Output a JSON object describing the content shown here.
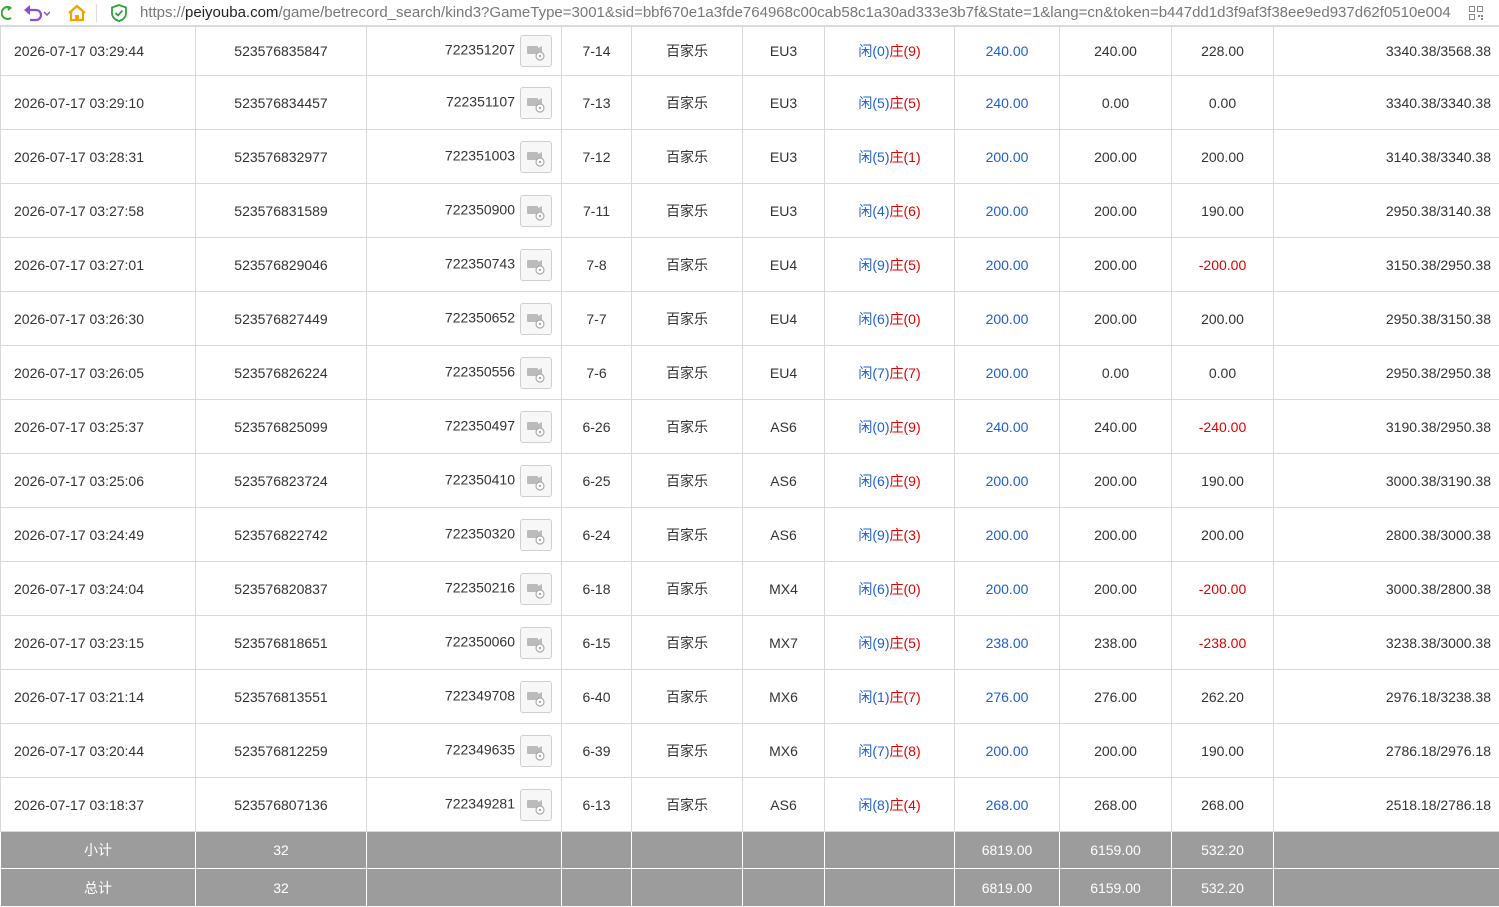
{
  "browser": {
    "url_scheme": "https://",
    "url_host": "peiyouba.com",
    "url_path": "/game/betrecord_search/kind3?GameType=3001&sid=bbf670e1a3fde764968c00cab58c1a30ad333e3b7f&State=1&lang=cn&token=b447dd1d3f9af3f38ee9ed937d62f0510e004",
    "icons": [
      "refresh-icon",
      "undo-icon",
      "home-icon",
      "shield-check-icon",
      "qr-code-icon"
    ]
  },
  "colors": {
    "positive": "#1f5fd0",
    "negative": "#e00000",
    "footer_bg": "#9c9c9c"
  },
  "rows": [
    {
      "time": "2026-07-17 03:29:44",
      "order": "523576835847",
      "round": "722351207",
      "table": "7-14",
      "game": "百家乐",
      "room": "EU3",
      "player": "闲(0)",
      "banker": "庄(9)",
      "bet": "240.00",
      "valid": "240.00",
      "win": "228.00",
      "win_neg": false,
      "balance": "3340.38/3568.38"
    },
    {
      "time": "2026-07-17 03:29:10",
      "order": "523576834457",
      "round": "722351107",
      "table": "7-13",
      "game": "百家乐",
      "room": "EU3",
      "player": "闲(5)",
      "banker": "庄(5)",
      "bet": "240.00",
      "valid": "0.00",
      "win": "0.00",
      "win_neg": false,
      "balance": "3340.38/3340.38"
    },
    {
      "time": "2026-07-17 03:28:31",
      "order": "523576832977",
      "round": "722351003",
      "table": "7-12",
      "game": "百家乐",
      "room": "EU3",
      "player": "闲(5)",
      "banker": "庄(1)",
      "bet": "200.00",
      "valid": "200.00",
      "win": "200.00",
      "win_neg": false,
      "balance": "3140.38/3340.38"
    },
    {
      "time": "2026-07-17 03:27:58",
      "order": "523576831589",
      "round": "722350900",
      "table": "7-11",
      "game": "百家乐",
      "room": "EU3",
      "player": "闲(4)",
      "banker": "庄(6)",
      "bet": "200.00",
      "valid": "200.00",
      "win": "190.00",
      "win_neg": false,
      "balance": "2950.38/3140.38"
    },
    {
      "time": "2026-07-17 03:27:01",
      "order": "523576829046",
      "round": "722350743",
      "table": "7-8",
      "game": "百家乐",
      "room": "EU4",
      "player": "闲(9)",
      "banker": "庄(5)",
      "bet": "200.00",
      "valid": "200.00",
      "win": "-200.00",
      "win_neg": true,
      "balance": "3150.38/2950.38"
    },
    {
      "time": "2026-07-17 03:26:30",
      "order": "523576827449",
      "round": "722350652",
      "table": "7-7",
      "game": "百家乐",
      "room": "EU4",
      "player": "闲(6)",
      "banker": "庄(0)",
      "bet": "200.00",
      "valid": "200.00",
      "win": "200.00",
      "win_neg": false,
      "balance": "2950.38/3150.38"
    },
    {
      "time": "2026-07-17 03:26:05",
      "order": "523576826224",
      "round": "722350556",
      "table": "7-6",
      "game": "百家乐",
      "room": "EU4",
      "player": "闲(7)",
      "banker": "庄(7)",
      "bet": "200.00",
      "valid": "0.00",
      "win": "0.00",
      "win_neg": false,
      "balance": "2950.38/2950.38"
    },
    {
      "time": "2026-07-17 03:25:37",
      "order": "523576825099",
      "round": "722350497",
      "table": "6-26",
      "game": "百家乐",
      "room": "AS6",
      "player": "闲(0)",
      "banker": "庄(9)",
      "bet": "240.00",
      "valid": "240.00",
      "win": "-240.00",
      "win_neg": true,
      "balance": "3190.38/2950.38"
    },
    {
      "time": "2026-07-17 03:25:06",
      "order": "523576823724",
      "round": "722350410",
      "table": "6-25",
      "game": "百家乐",
      "room": "AS6",
      "player": "闲(6)",
      "banker": "庄(9)",
      "bet": "200.00",
      "valid": "200.00",
      "win": "190.00",
      "win_neg": false,
      "balance": "3000.38/3190.38"
    },
    {
      "time": "2026-07-17 03:24:49",
      "order": "523576822742",
      "round": "722350320",
      "table": "6-24",
      "game": "百家乐",
      "room": "AS6",
      "player": "闲(9)",
      "banker": "庄(3)",
      "bet": "200.00",
      "valid": "200.00",
      "win": "200.00",
      "win_neg": false,
      "balance": "2800.38/3000.38"
    },
    {
      "time": "2026-07-17 03:24:04",
      "order": "523576820837",
      "round": "722350216",
      "table": "6-18",
      "game": "百家乐",
      "room": "MX4",
      "player": "闲(6)",
      "banker": "庄(0)",
      "bet": "200.00",
      "valid": "200.00",
      "win": "-200.00",
      "win_neg": true,
      "balance": "3000.38/2800.38"
    },
    {
      "time": "2026-07-17 03:23:15",
      "order": "523576818651",
      "round": "722350060",
      "table": "6-15",
      "game": "百家乐",
      "room": "MX7",
      "player": "闲(9)",
      "banker": "庄(5)",
      "bet": "238.00",
      "valid": "238.00",
      "win": "-238.00",
      "win_neg": true,
      "balance": "3238.38/3000.38"
    },
    {
      "time": "2026-07-17 03:21:14",
      "order": "523576813551",
      "round": "722349708",
      "table": "6-40",
      "game": "百家乐",
      "room": "MX6",
      "player": "闲(1)",
      "banker": "庄(7)",
      "bet": "276.00",
      "valid": "276.00",
      "win": "262.20",
      "win_neg": false,
      "balance": "2976.18/3238.38"
    },
    {
      "time": "2026-07-17 03:20:44",
      "order": "523576812259",
      "round": "722349635",
      "table": "6-39",
      "game": "百家乐",
      "room": "MX6",
      "player": "闲(7)",
      "banker": "庄(8)",
      "bet": "200.00",
      "valid": "200.00",
      "win": "190.00",
      "win_neg": false,
      "balance": "2786.18/2976.18"
    },
    {
      "time": "2026-07-17 03:18:37",
      "order": "523576807136",
      "round": "722349281",
      "table": "6-13",
      "game": "百家乐",
      "room": "AS6",
      "player": "闲(8)",
      "banker": "庄(4)",
      "bet": "268.00",
      "valid": "268.00",
      "win": "268.00",
      "win_neg": false,
      "balance": "2518.18/2786.18"
    }
  ],
  "subtotal": {
    "label": "小计",
    "count": "32",
    "bet": "6819.00",
    "valid": "6159.00",
    "win": "532.20"
  },
  "total": {
    "label": "总计",
    "count": "32",
    "bet": "6819.00",
    "valid": "6159.00",
    "win": "532.20"
  }
}
